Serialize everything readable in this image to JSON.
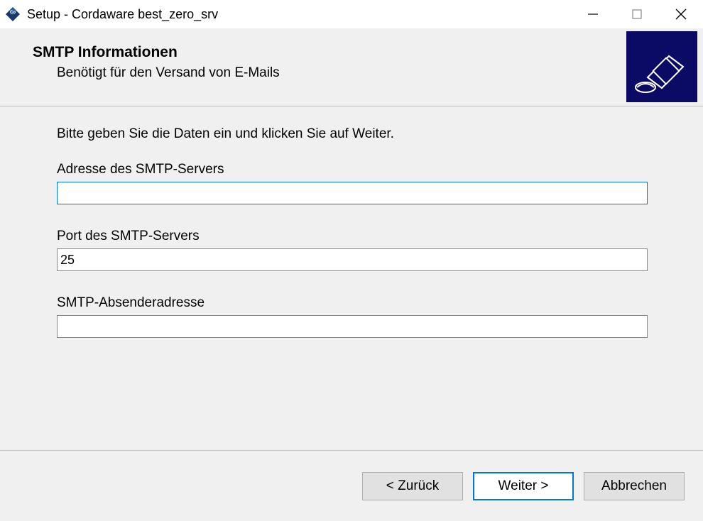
{
  "window": {
    "title": "Setup - Cordaware best_zero_srv"
  },
  "header": {
    "title": "SMTP Informationen",
    "subtitle": "Benötigt für den Versand von E-Mails"
  },
  "content": {
    "intro": "Bitte geben Sie die Daten ein und klicken Sie auf Weiter.",
    "fields": [
      {
        "label": "Adresse des SMTP-Servers",
        "value": ""
      },
      {
        "label": "Port des SMTP-Servers",
        "value": "25"
      },
      {
        "label": "SMTP-Absenderadresse",
        "value": ""
      }
    ]
  },
  "footer": {
    "back": "< Zurück",
    "next": "Weiter >",
    "cancel": "Abbrechen"
  }
}
